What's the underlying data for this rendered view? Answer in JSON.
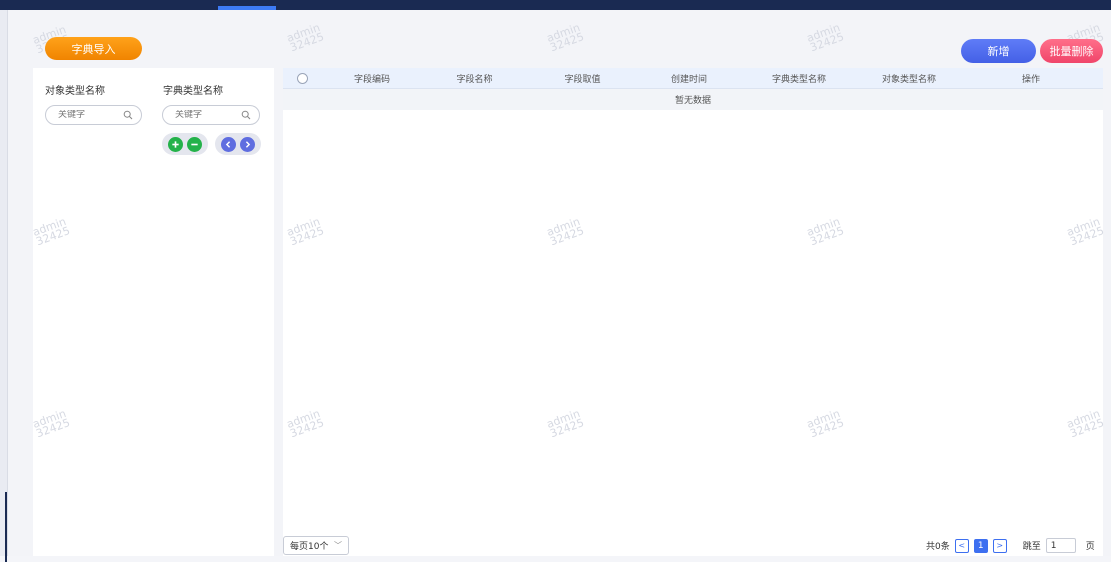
{
  "toolbar": {
    "import_label": "字典导入",
    "add_label": "新增",
    "batch_delete_label": "批量删除"
  },
  "sidebar": {
    "object_type_title": "对象类型名称",
    "dict_type_title": "字典类型名称",
    "object_search_placeholder": "关键字",
    "dict_search_placeholder": "关键字",
    "action_icons": [
      "add-circle-icon",
      "remove-circle-icon",
      "chevron-left-icon",
      "chevron-right-icon"
    ]
  },
  "table": {
    "columns": [
      "字段编码",
      "字段名称",
      "字段取值",
      "创建时间",
      "字典类型名称",
      "对象类型名称",
      "操作"
    ],
    "rows": [],
    "empty_text": "暂无数据"
  },
  "pagination": {
    "page_size_label": "每页10个",
    "total_text": "共0条",
    "current_page": "1",
    "jump_label": "跳至",
    "jump_value": "1",
    "page_suffix": "页"
  },
  "watermark": {
    "line1": "admin",
    "line2": "32425"
  },
  "colors": {
    "import_button": "#f59300",
    "add_button": "#4f6cef",
    "delete_button": "#f25573",
    "header_bar": "#1a2a52",
    "table_header": "#eaf1fd",
    "green_action": "#24b24a",
    "blue_action": "#5f6de0"
  }
}
